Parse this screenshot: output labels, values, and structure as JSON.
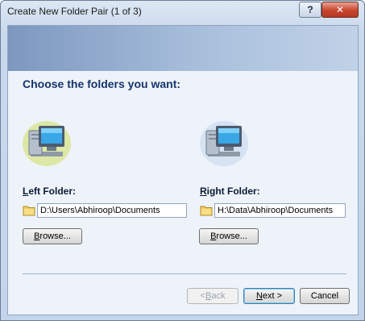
{
  "window": {
    "title": "Create New Folder Pair (1 of 3)",
    "help_label": "?",
    "close_label": "✕"
  },
  "page": {
    "heading": "Choose the folders you want:"
  },
  "left": {
    "label_mnemonic": "L",
    "label_rest": "eft Folder:",
    "path": "D:\\Users\\Abhiroop\\Documents",
    "browse_mnemonic": "B",
    "browse_rest": "rowse..."
  },
  "right": {
    "label_mnemonic": "R",
    "label_rest": "ight Folder:",
    "path": "H:\\Data\\Abhiroop\\Documents",
    "browse_mnemonic": "B",
    "browse_rest": "rowse..."
  },
  "footer": {
    "back_prefix": "< ",
    "back_mnemonic": "B",
    "back_rest": "ack",
    "next_mnemonic": "N",
    "next_rest": "ext >",
    "cancel_label": "Cancel"
  },
  "colors": {
    "heading": "#15346a",
    "banner_start": "#7d97bf",
    "close_button": "#c8452d"
  },
  "icons": {
    "left_computer": "computer-icon",
    "right_computer": "computer-icon",
    "folder": "folder-icon"
  }
}
